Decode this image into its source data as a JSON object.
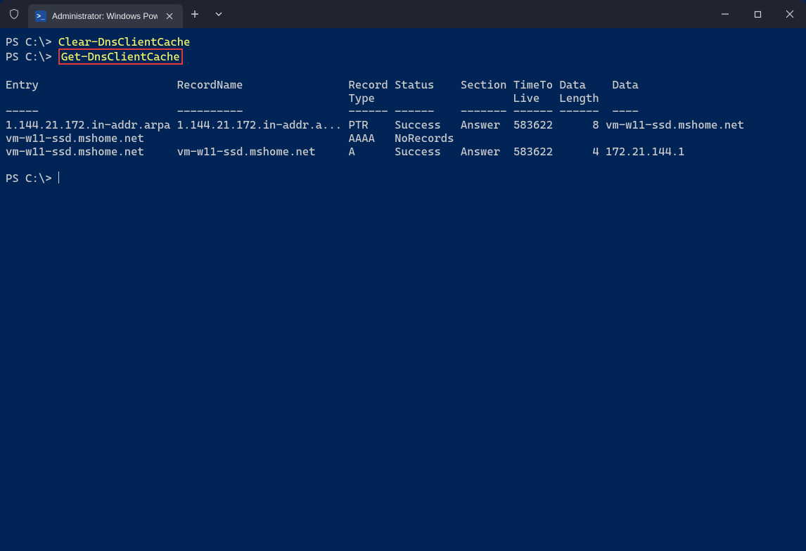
{
  "titlebar": {
    "tab_title": "Administrator: Windows Powe",
    "ps_icon_text": ">_"
  },
  "terminal": {
    "prompt": "PS C:\\>",
    "cmd1": "Clear-DnsClientCache",
    "cmd2": "Get-DnsClientCache",
    "headers": {
      "entry": "Entry",
      "record_name": "RecordName",
      "record": "Record",
      "type": "Type",
      "status": "Status",
      "section": "Section",
      "time_to": "TimeTo",
      "live": "Live",
      "data_h": "Data",
      "length": "Length",
      "data": "Data"
    },
    "dividers": {
      "entry": "-----",
      "record_name": "----------",
      "record": "------",
      "status": "------",
      "section": "-------",
      "time_to": "------",
      "data_len": "------",
      "data": "----"
    },
    "rows": [
      {
        "entry": "1.144.21.172.in-addr.arpa",
        "record_name": "1.144.21.172.in-addr.a...",
        "record": "PTR",
        "status": "Success",
        "section": "Answer",
        "ttl": "583622",
        "len": "8",
        "data": "vm-w11-ssd.mshome.net"
      },
      {
        "entry": "vm-w11-ssd.mshome.net",
        "record_name": "",
        "record": "AAAA",
        "status": "NoRecords",
        "section": "",
        "ttl": "",
        "len": "",
        "data": ""
      },
      {
        "entry": "vm-w11-ssd.mshome.net",
        "record_name": "vm-w11-ssd.mshome.net",
        "record": "A",
        "status": "Success",
        "section": "Answer",
        "ttl": "583622",
        "len": "4",
        "data": "172.21.144.1"
      }
    ]
  }
}
